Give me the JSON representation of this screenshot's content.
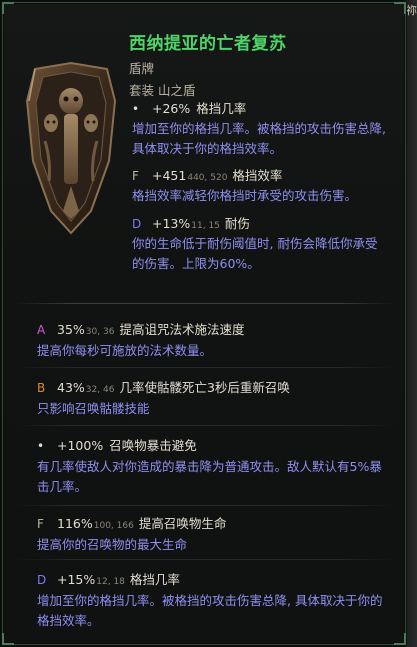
{
  "edge_glyph": "祢",
  "item": {
    "name": "西纳提亚的亡者复苏",
    "type": "盾牌",
    "set_line": "套装 山之盾",
    "icon": "tower-shield-icon"
  },
  "affixes": [
    {
      "marker": "•",
      "value": "+26%",
      "range": "",
      "name": "格挡几率",
      "desc": "增加至你的格挡几率。被格挡的攻击伤害总降, 具体取决于你的格挡效率。"
    },
    {
      "marker": "F",
      "value": "+451",
      "range": "440, 520",
      "name": "格挡效率",
      "desc": "格挡效率减轻你格挡时承受的攻击伤害。"
    },
    {
      "marker": "D",
      "value": "+13%",
      "range": "11, 15",
      "name": "耐伤",
      "desc": "你的生命低于耐伤阈值时, 耐伤会降低你承受的伤害。上限为60%。"
    }
  ],
  "aspects": [
    {
      "marker": "A",
      "value": "35%",
      "range": "30, 36",
      "name": "提高诅咒法术施法速度",
      "desc": "提高你每秒可施放的法术数量。"
    },
    {
      "marker": "B",
      "value": "43%",
      "range": "32, 46",
      "name": "几率使骷髅死亡3秒后重新召唤",
      "desc": "只影响召唤骷髅技能"
    },
    {
      "marker": "•",
      "value": "+100%",
      "range": "",
      "name": "召唤物暴击避免",
      "desc": "有几率使敌人对你造成的暴击降为普通攻击。敌人默认有5%暴击几率。"
    },
    {
      "marker": "F",
      "value": "116%",
      "range": "100, 166",
      "name": "提高召唤物生命",
      "desc": "提高你的召唤物的最大生命"
    },
    {
      "marker": "D",
      "value": "+15%",
      "range": "12, 18",
      "name": "格挡几率",
      "desc": "增加至你的格挡几率。被格挡的攻击伤害总降, 具体取决于你的格挡效率。"
    }
  ],
  "colors": {
    "title": "#4fd46a",
    "description": "#8f8ff0",
    "frame": "#2d4a35"
  }
}
